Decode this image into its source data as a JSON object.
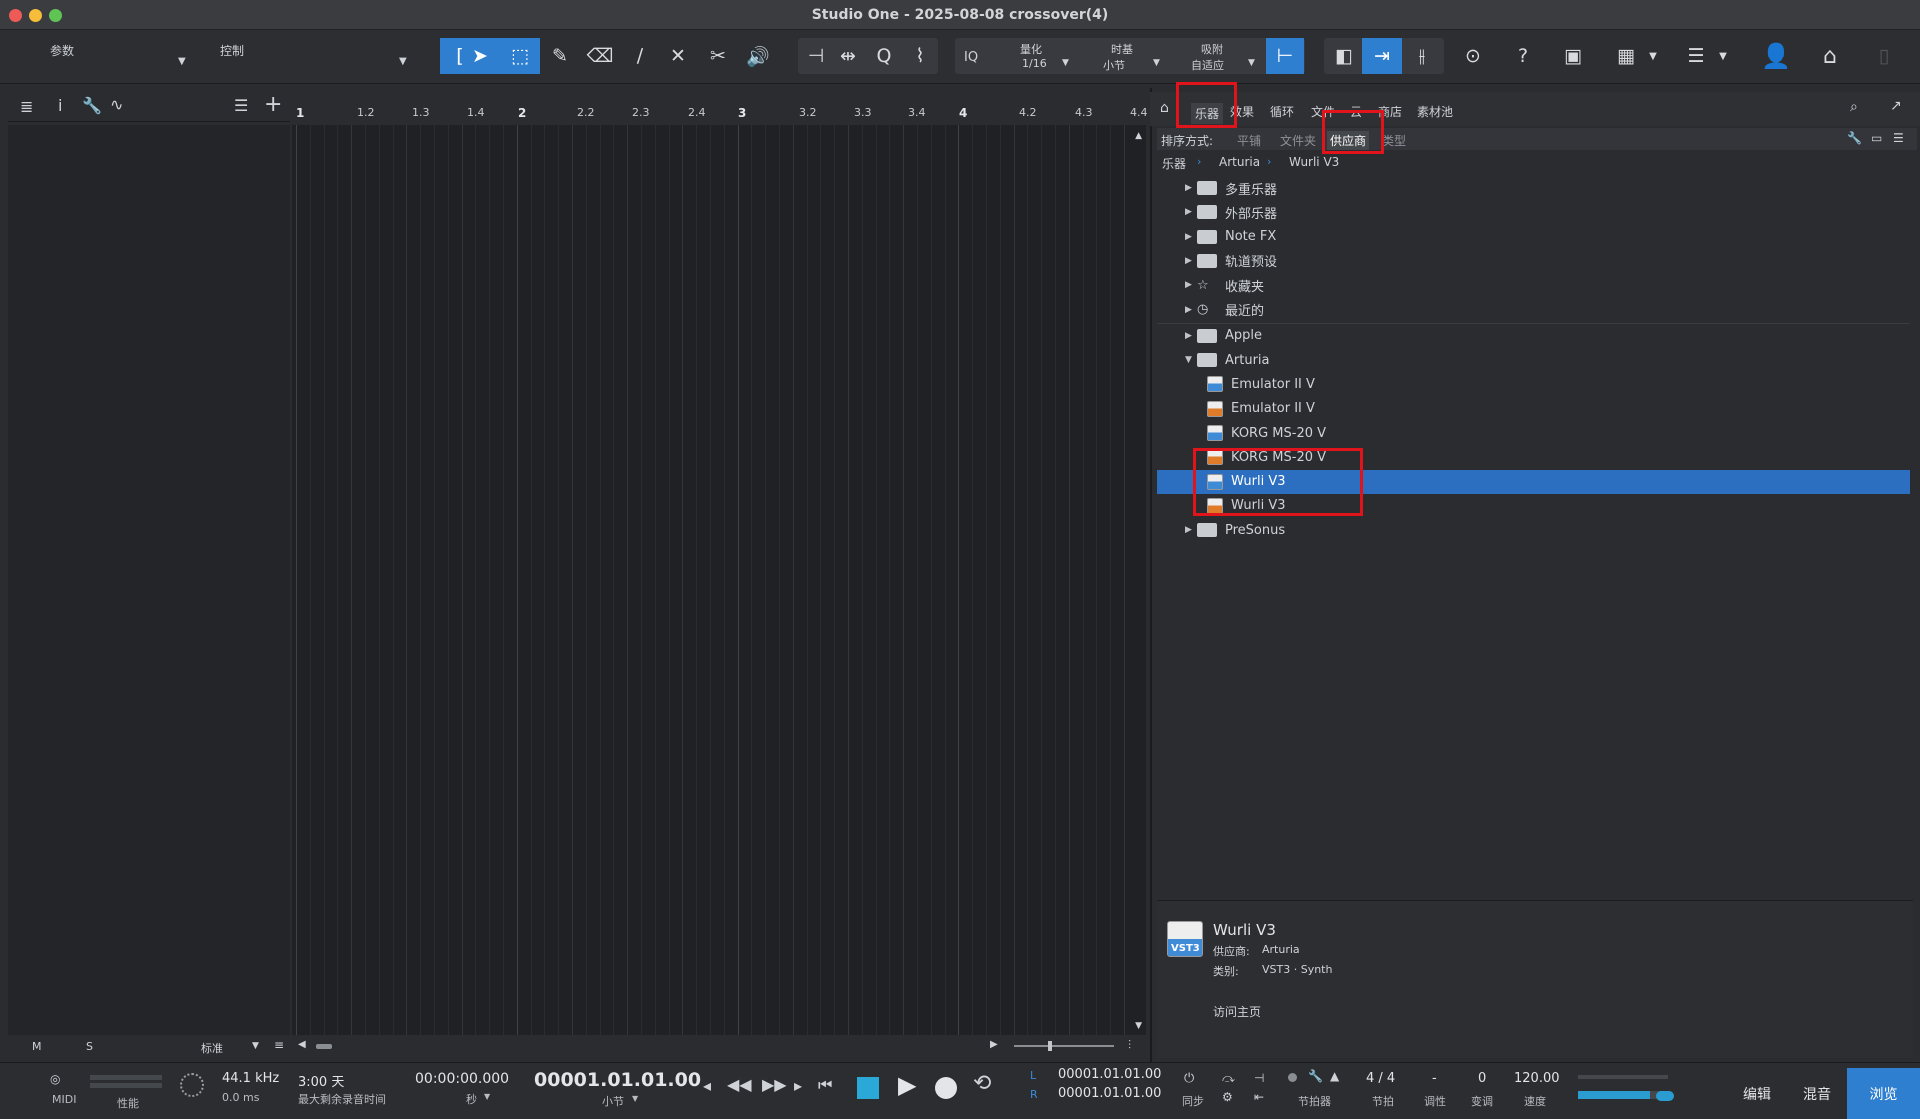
{
  "window": {
    "title": "Studio One - 2025-08-08 crossover(4)"
  },
  "toolbar": {
    "params_label": "参数",
    "control_label": "控制",
    "iq_label": "IQ",
    "quantize_label": "量化",
    "quantize_value": "1/16",
    "timebase_label": "时基",
    "timebase_value": "小节",
    "snap_label": "吸附",
    "snap_value": "自适应"
  },
  "ruler": {
    "marks": [
      "1",
      "1.2",
      "1.3",
      "1.4",
      "2",
      "2.2",
      "2.3",
      "2.4",
      "3",
      "3.2",
      "3.3",
      "3.4",
      "4",
      "4.2",
      "4.3",
      "4.4"
    ]
  },
  "track_footer": {
    "m": "M",
    "s": "S",
    "mode": "标准"
  },
  "browser": {
    "tabs": [
      "乐器",
      "效果",
      "循环",
      "文件",
      "云",
      "商店",
      "素材池"
    ],
    "sort_label": "排序方式:",
    "sort_options": [
      "平铺",
      "文件夹",
      "供应商",
      "类型"
    ],
    "breadcrumb": [
      "乐器",
      "Arturia",
      "Wurli V3"
    ],
    "items": [
      {
        "label": "多重乐器"
      },
      {
        "label": "外部乐器"
      },
      {
        "label": "Note FX"
      },
      {
        "label": "轨道预设"
      },
      {
        "label": "收藏夹"
      },
      {
        "label": "最近的"
      },
      {
        "label": "Apple"
      },
      {
        "label": "Arturia"
      },
      {
        "label": "Emulator II V"
      },
      {
        "label": "Emulator II V"
      },
      {
        "label": "KORG MS-20 V"
      },
      {
        "label": "KORG MS-20 V"
      },
      {
        "label": "Wurli V3"
      },
      {
        "label": "Wurli V3"
      },
      {
        "label": "PreSonus"
      }
    ],
    "info": {
      "name": "Wurli V3",
      "vendor_label": "供应商:",
      "vendor": "Arturia",
      "type_label": "类别:",
      "type": "VST3 · Synth",
      "badge": "VST3",
      "homepage": "访问主页"
    }
  },
  "transport": {
    "midi": "MIDI",
    "perf": "性能",
    "sample_rate": "44.1 kHz",
    "latency": "0.0 ms",
    "record_time": "3:00 天",
    "record_time_label": "最大剩余录音时间",
    "seconds": "00:00:00.000",
    "seconds_label": "秒",
    "bars": "00001.01.01.00",
    "bars_label": "小节",
    "loop_l": "00001.01.01.00",
    "loop_r": "00001.01.01.00",
    "l": "L",
    "r": "R",
    "sync": "同步",
    "metronome": "节拍器",
    "signature": "4 / 4",
    "signature_label": "节拍",
    "key": "-",
    "key_label": "调性",
    "transpose": "0",
    "transpose_label": "变调",
    "tempo": "120.00",
    "tempo_label": "速度"
  },
  "nav": {
    "edit": "编辑",
    "mix": "混音",
    "browse": "浏览"
  },
  "colors": {
    "accent": "#2f7fd1",
    "highlight_box": "#e1141b"
  }
}
